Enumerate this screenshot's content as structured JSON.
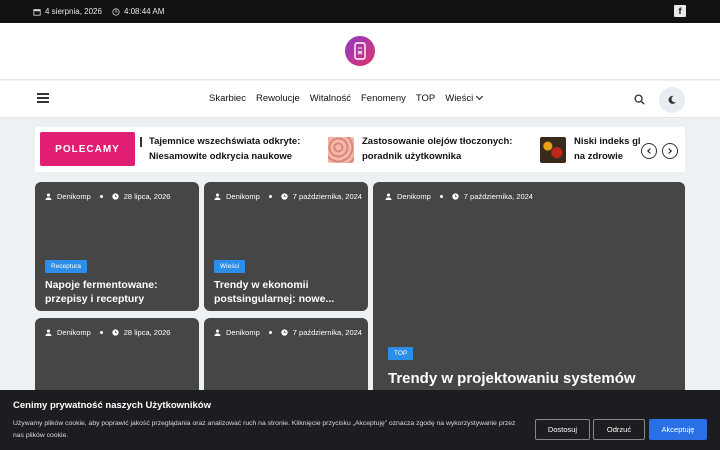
{
  "topbar": {
    "date": "4 sierpnia, 2026",
    "time": "4:08:44 AM",
    "facebook_icon": "facebook-icon"
  },
  "nav": {
    "items": [
      "Skarbiec",
      "Rewolucje",
      "Witalność",
      "Fenomeny",
      "TOP",
      "Wieści"
    ]
  },
  "ticker": {
    "label": "POLECAMY",
    "items": [
      {
        "line1": "Tajemnice wszechświata odkryte:",
        "line2": "Niesamowite odkrycia naukowe"
      },
      {
        "line1": "Zastosowanie olejów tłoczonych:",
        "line2": "poradnik użytkownika"
      },
      {
        "line1": "Niski indeks gl",
        "line2": "na zdrowie"
      }
    ]
  },
  "cards": [
    {
      "author": "Denikomp",
      "date": "28 lipca, 2026",
      "badge": "Receptura",
      "title1": "Napoje fermentowane:",
      "title2": "przepisy i receptury"
    },
    {
      "author": "Denikomp",
      "date": "7 października, 2024",
      "badge": "Wieści",
      "title1": "Trendy w ekonomii",
      "title2": "postsingularnej: nowe..."
    },
    {
      "author": "Denikomp",
      "date": "7 października, 2024",
      "badge": "TOP",
      "title1": "Trendy w projektowaniu systemów",
      "title2": ""
    },
    {
      "author": "Denikomp",
      "date": "28 lipca, 2026"
    },
    {
      "author": "Denikomp",
      "date": "7 października, 2024"
    }
  ],
  "cookie": {
    "heading": "Cenimy prywatność naszych Użytkowników",
    "text": "Używamy plików cookie, aby poprawić jakość przeglądania oraz analizować ruch na stronie. Kliknięcie przycisku „Akceptuję” oznacza zgodę na wykorzystywanie przez nas plików cookie.",
    "customize": "Dostosuj",
    "reject": "Odrzuć",
    "accept": "Akceptuję",
    "accent": "#2b6fe6"
  }
}
